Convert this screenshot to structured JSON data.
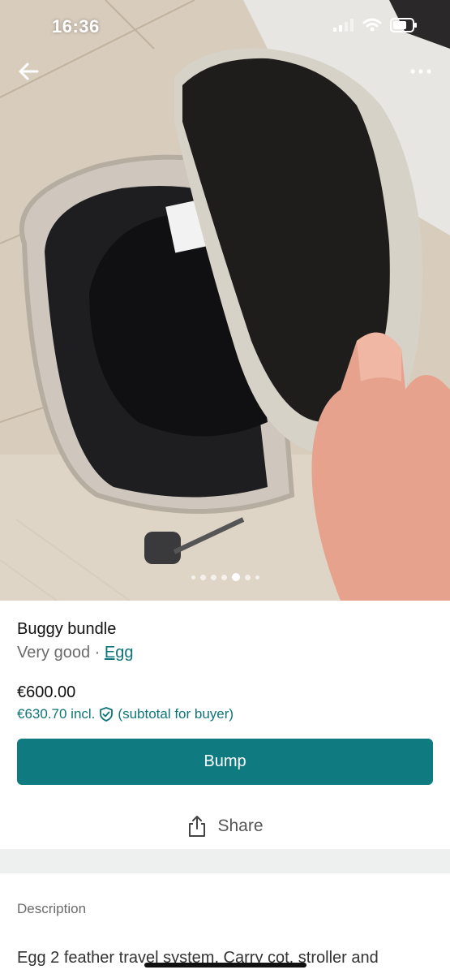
{
  "status_bar": {
    "time": "16:36"
  },
  "gallery": {
    "image_description": "Black pram carrycot with beige frame and a hand lifting the hood",
    "page_count": 7,
    "active_page": 5
  },
  "item": {
    "title": "Buggy bundle",
    "condition": "Very good",
    "separator": " · ",
    "brand": "Egg",
    "price": "€600.00",
    "price_incl": "€630.70 incl.",
    "price_incl_note": "(subtotal for buyer)"
  },
  "actions": {
    "bump_label": "Bump",
    "share_label": "Share"
  },
  "description": {
    "heading": "Description",
    "text": "Egg 2  feather travel system. Carry cot, stroller and"
  },
  "colors": {
    "accent": "#0f7a80",
    "link": "#0e7479"
  },
  "icons": {
    "back": "arrow-left-icon",
    "more": "more-dots-icon",
    "shield": "shield-check-icon",
    "share": "share-icon"
  }
}
